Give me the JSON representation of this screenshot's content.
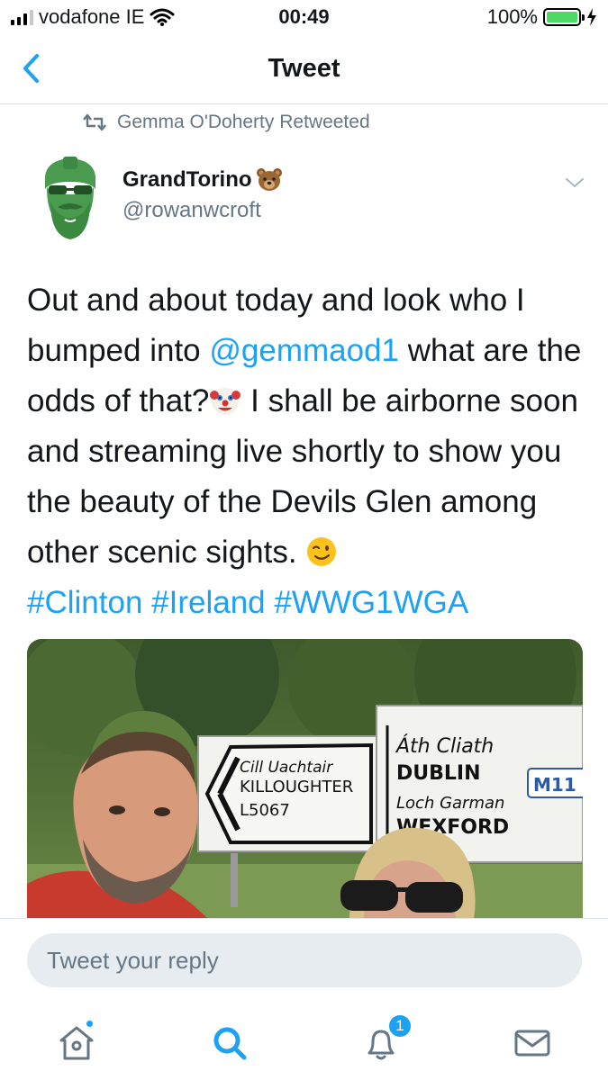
{
  "status_bar": {
    "carrier": "vodafone IE",
    "time": "00:49",
    "battery": "100%",
    "battery_level": 1.0
  },
  "nav": {
    "back_icon": "chevron-left-icon",
    "title": "Tweet"
  },
  "retweet": {
    "icon": "retweet-icon",
    "label": "Gemma O'Doherty Retweeted"
  },
  "author": {
    "name": "GrandTorino",
    "emoji": "bear-face-emoji",
    "handle": "@rowanwcroft"
  },
  "tweet": {
    "seg1": "Out and about today and look who I bumped into ",
    "mention": "@gemmaod1",
    "seg2": " what are the odds of that?",
    "emoji1": "clown-face-emoji",
    "seg3": " I shall be airborne soon and streaming live shortly to show you the beauty of the Devils Glen among other scenic sights. ",
    "emoji2": "winking-face-emoji",
    "hashtags": [
      "#Clinton",
      "#Ireland",
      "#WWG1WGA"
    ]
  },
  "media": {
    "sign_left": {
      "irish": "Cill Uachtair",
      "english": "KILLOUGHTER",
      "road": "L5067"
    },
    "sign_right": {
      "irish1": "Áth Cliath",
      "english1": "DUBLIN",
      "irish2": "Loch Garman",
      "english2": "WEXFORD",
      "road": "M11"
    }
  },
  "reply": {
    "placeholder": "Tweet your reply"
  },
  "tabbar": {
    "home_icon": "home-icon",
    "search_icon": "search-icon",
    "notifications_icon": "bell-icon",
    "notifications_count": "1",
    "messages_icon": "mail-icon"
  },
  "colors": {
    "accent": "#1da1f2",
    "text": "#14171a",
    "secondary": "#657786",
    "battery": "#4cd964"
  }
}
